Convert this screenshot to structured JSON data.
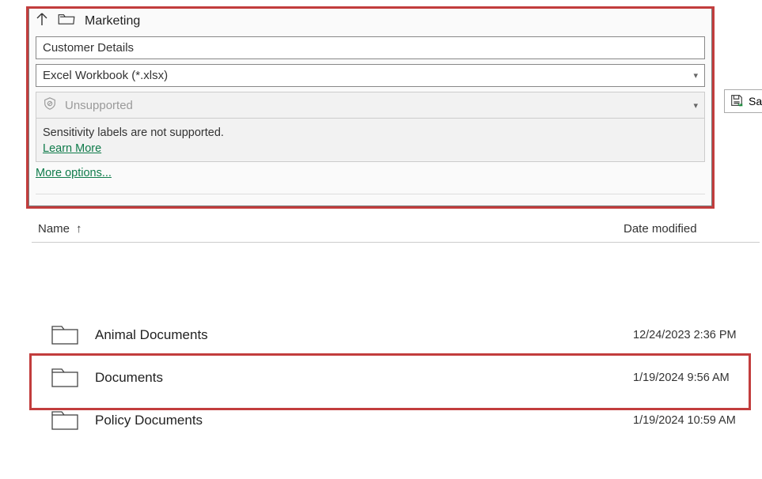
{
  "breadcrumb": {
    "current": "Marketing"
  },
  "filename": {
    "value": "Customer Details"
  },
  "filetype": {
    "selected": "Excel Workbook (*.xlsx)"
  },
  "sensitivity": {
    "label": "Unsupported",
    "message": "Sensitivity labels are not supported.",
    "learn_more": "Learn More"
  },
  "more_options": "More options...",
  "save_button": {
    "label": "Sa"
  },
  "list": {
    "columns": {
      "name": "Name",
      "date": "Date modified"
    },
    "rows": [
      {
        "name": "Animal Documents",
        "date": "12/24/2023 2:36 PM"
      },
      {
        "name": "Documents",
        "date": "1/19/2024 9:56 AM"
      },
      {
        "name": "Policy Documents",
        "date": "1/19/2024 10:59 AM"
      }
    ]
  }
}
